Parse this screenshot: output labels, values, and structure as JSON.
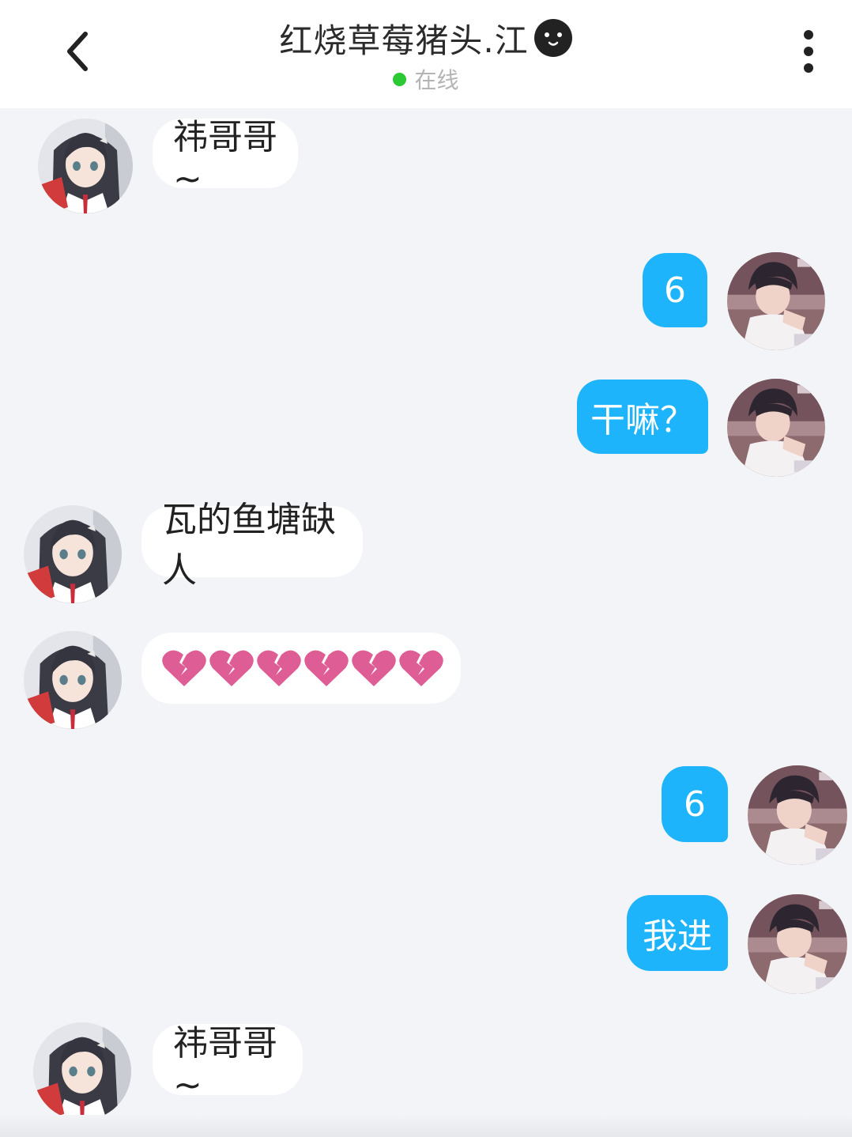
{
  "header": {
    "back_icon": "chevron-left-icon",
    "title": "红烧草莓猪头.江",
    "title_emoji": "smiling-face-icon",
    "status_text": "在线",
    "status_color": "#2bc934",
    "more_icon": "more-vertical-icon"
  },
  "colors": {
    "outgoing_bubble": "#1eb4fb",
    "incoming_bubble": "#ffffff",
    "background": "#f2f4f7",
    "heart": "#de5d95"
  },
  "messages": [
    {
      "direction": "incoming",
      "text": "祎哥哥~"
    },
    {
      "direction": "outgoing",
      "text": "6"
    },
    {
      "direction": "outgoing",
      "text": "干嘛？"
    },
    {
      "direction": "incoming",
      "text": "瓦的鱼塘缺人"
    },
    {
      "direction": "incoming",
      "emoji": "broken-heart-icon",
      "emoji_count": 6
    },
    {
      "direction": "outgoing",
      "text": "6"
    },
    {
      "direction": "outgoing",
      "text": "我进"
    },
    {
      "direction": "incoming",
      "text": "祎哥哥~"
    }
  ]
}
